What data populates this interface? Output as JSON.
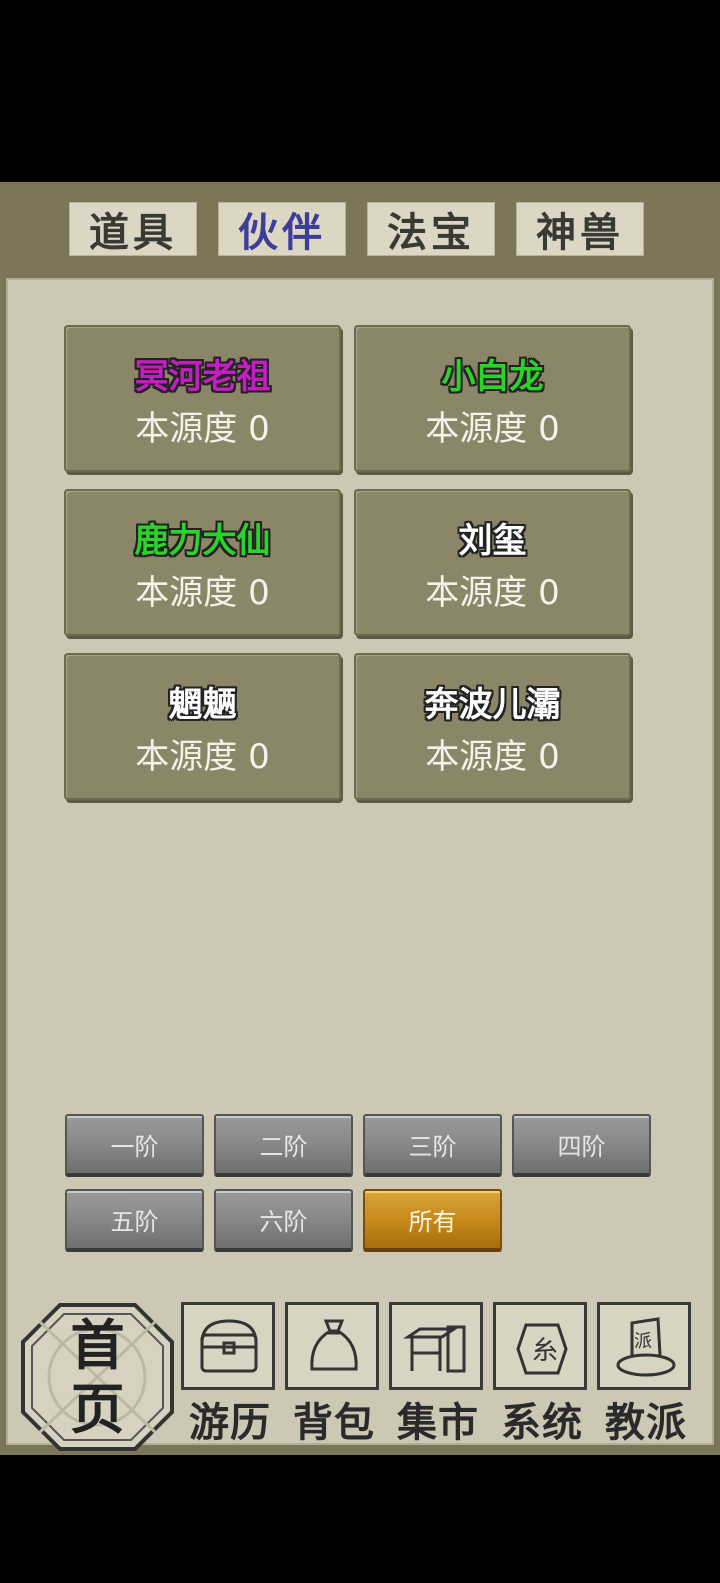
{
  "tabs": [
    {
      "label": "道具"
    },
    {
      "label": "伙伴",
      "active": true
    },
    {
      "label": "法宝"
    },
    {
      "label": "神兽"
    }
  ],
  "partners": [
    {
      "name": "冥河老祖",
      "color": "#c21ec2",
      "stat": "本源度 0"
    },
    {
      "name": "小白龙",
      "color": "#2bd42b",
      "stat": "本源度 0"
    },
    {
      "name": "鹿力大仙",
      "color": "#2bd42b",
      "stat": "本源度 0"
    },
    {
      "name": "刘玺",
      "color": "#ffffff",
      "stat": "本源度 0"
    },
    {
      "name": "魍魉",
      "color": "#ffffff",
      "stat": "本源度 0"
    },
    {
      "name": "奔波儿灞",
      "color": "#ffffff",
      "stat": "本源度 0"
    }
  ],
  "tiers": [
    {
      "label": "一阶"
    },
    {
      "label": "二阶"
    },
    {
      "label": "三阶"
    },
    {
      "label": "四阶"
    },
    {
      "label": "五阶"
    },
    {
      "label": "六阶"
    },
    {
      "label": "所有",
      "active": true
    }
  ],
  "bottom_nav": {
    "home": {
      "line1": "首",
      "line2": "页"
    },
    "items": [
      {
        "label": "游历",
        "icon": "chest-icon"
      },
      {
        "label": "背包",
        "icon": "bag-icon"
      },
      {
        "label": "集市",
        "icon": "market-stall-icon"
      },
      {
        "label": "系统",
        "icon": "system-seal-icon"
      },
      {
        "label": "教派",
        "icon": "sect-scroll-icon"
      }
    ]
  }
}
